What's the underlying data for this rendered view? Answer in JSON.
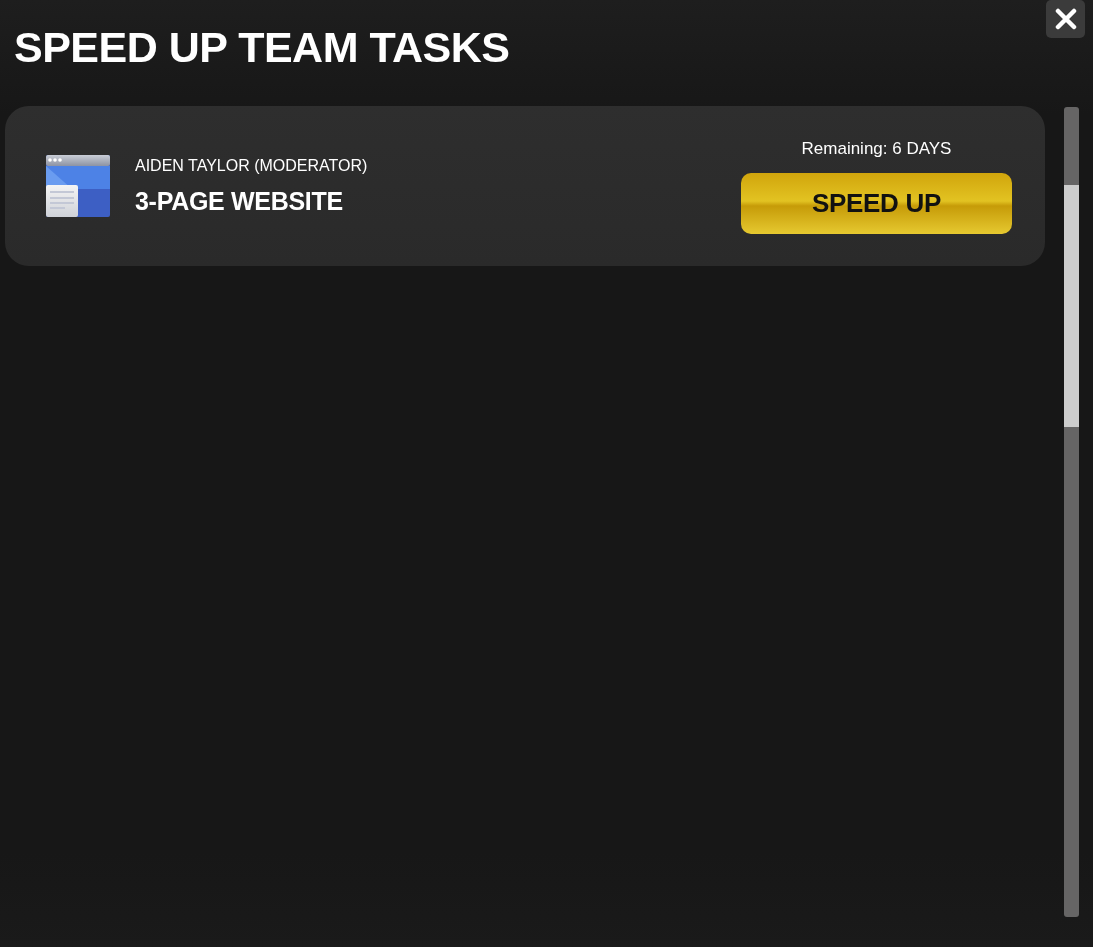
{
  "dialog": {
    "title": "SPEED UP TEAM TASKS"
  },
  "tasks": [
    {
      "assignee": "AIDEN TAYLOR (MODERATOR)",
      "title": "3-PAGE WEBSITE",
      "remaining": "Remaining: 6 DAYS",
      "action": "SPEED UP"
    }
  ]
}
